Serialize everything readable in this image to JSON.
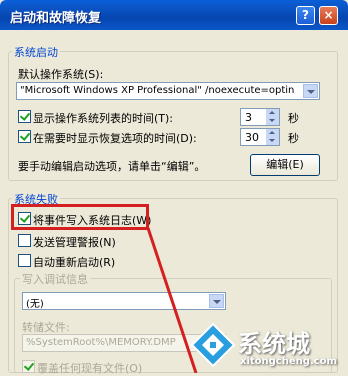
{
  "window": {
    "title": "启动和故障恢复",
    "help_glyph": "?",
    "close_glyph": "×"
  },
  "startup": {
    "group_label": "系统启动",
    "default_os_label": "默认操作系统(S):",
    "default_os_value": "\"Microsoft Windows XP Professional\" /noexecute=optin",
    "show_list_label": "显示操作系统列表的时间(T):",
    "show_list_checked": true,
    "show_list_value": "3",
    "show_recovery_label": "在需要时显示恢复选项的时间(D):",
    "show_recovery_checked": true,
    "show_recovery_value": "30",
    "seconds_unit": "秒",
    "edit_hint": "要手动编辑启动选项，请单击“编辑”。",
    "edit_button": "编辑(E)"
  },
  "failure": {
    "group_label": "系统失败",
    "write_event_label": "将事件写入系统日志(W)",
    "write_event_checked": true,
    "send_alert_label": "发送管理警报(N)",
    "send_alert_checked": false,
    "auto_restart_label": "自动重新启动(R)",
    "auto_restart_checked": false
  },
  "debug": {
    "group_label": "写入调试信息",
    "mode_value": "(无)",
    "dump_file_label": "转储文件:",
    "dump_file_value": "%SystemRoot%\\MEMORY.DMP",
    "overwrite_label": "覆盖任何现有文件(O)",
    "overwrite_checked": true
  },
  "watermark": {
    "brand": "系统城",
    "url": "xitongcheng.com"
  },
  "colors": {
    "highlight": "#d42020",
    "titlebar": "#0a5fd8",
    "group_label": "#0046d5"
  }
}
